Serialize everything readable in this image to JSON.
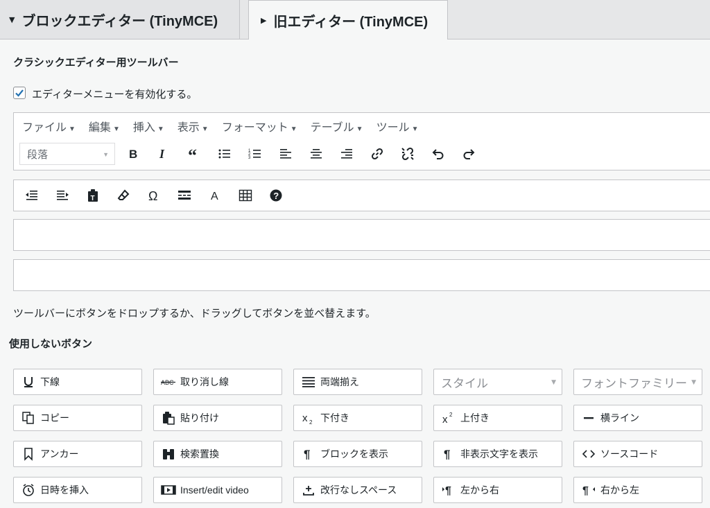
{
  "tabs": [
    {
      "arrow": "▼",
      "label": "ブロックエディター (TinyMCE)"
    },
    {
      "arrow": "▶",
      "label": "旧エディター (TinyMCE)"
    }
  ],
  "classic_toolbar_heading": "クラシックエディター用ツールバー",
  "enable_menu_checkbox": {
    "checked": true,
    "label": "エディターメニューを有効化する。"
  },
  "menubar": [
    {
      "label": "ファイル",
      "caret": "▼"
    },
    {
      "label": "編集",
      "caret": "▼"
    },
    {
      "label": "挿入",
      "caret": "▼"
    },
    {
      "label": "表示",
      "caret": "▼"
    },
    {
      "label": "フォーマット",
      "caret": "▼"
    },
    {
      "label": "テーブル",
      "caret": "▼"
    },
    {
      "label": "ツール",
      "caret": "▼"
    }
  ],
  "toolbar1": {
    "format_select": "段落",
    "buttons": [
      "bold-icon",
      "italic-icon",
      "blockquote-icon",
      "bullet-list-icon",
      "numbered-list-icon",
      "align-left-icon",
      "align-center-icon",
      "align-right-icon",
      "link-icon",
      "unlink-icon",
      "undo-icon",
      "redo-icon"
    ]
  },
  "toolbar2": {
    "buttons": [
      "outdent-icon",
      "indent-icon",
      "paste-text-icon",
      "clear-formatting-icon",
      "special-character-icon",
      "read-more-icon",
      "text-color-icon",
      "table-icon",
      "help-icon"
    ]
  },
  "drop_hint": "ツールバーにボタンをドロップするか、ドラッグしてボタンを並べ替えます。",
  "unused_heading": "使用しないボタン",
  "unused_buttons": [
    {
      "icon": "underline-icon",
      "label": "下線"
    },
    {
      "icon": "strikethrough-icon",
      "label": "取り消し線"
    },
    {
      "icon": "justify-icon",
      "label": "両端揃え"
    },
    {
      "icon": "",
      "label": "スタイル",
      "select": true
    },
    {
      "icon": "",
      "label": "フォントファミリー",
      "select": true
    },
    {
      "icon": "copy-icon",
      "label": "コピー"
    },
    {
      "icon": "paste-icon",
      "label": "貼り付け"
    },
    {
      "icon": "subscript-icon",
      "label": "下付き"
    },
    {
      "icon": "superscript-icon",
      "label": "上付き"
    },
    {
      "icon": "horizontal-line-icon",
      "label": "横ライン"
    },
    {
      "icon": "bookmark-icon",
      "label": "アンカー"
    },
    {
      "icon": "binoculars-icon",
      "label": "検索置換"
    },
    {
      "icon": "pilcrow-icon",
      "label": "ブロックを表示"
    },
    {
      "icon": "pilcrow-icon",
      "label": "非表示文字を表示"
    },
    {
      "icon": "code-icon",
      "label": "ソースコード"
    },
    {
      "icon": "clock-icon",
      "label": "日時を挿入"
    },
    {
      "icon": "video-icon",
      "label": "Insert/edit video"
    },
    {
      "icon": "nbsp-icon",
      "label": "改行なしスペース"
    },
    {
      "icon": "ltr-icon",
      "label": "左から右"
    },
    {
      "icon": "rtl-icon",
      "label": "右から左"
    }
  ],
  "colors": {
    "accent": "#2271b1",
    "border": "#c3c4c7",
    "background": "#f6f7f7"
  }
}
